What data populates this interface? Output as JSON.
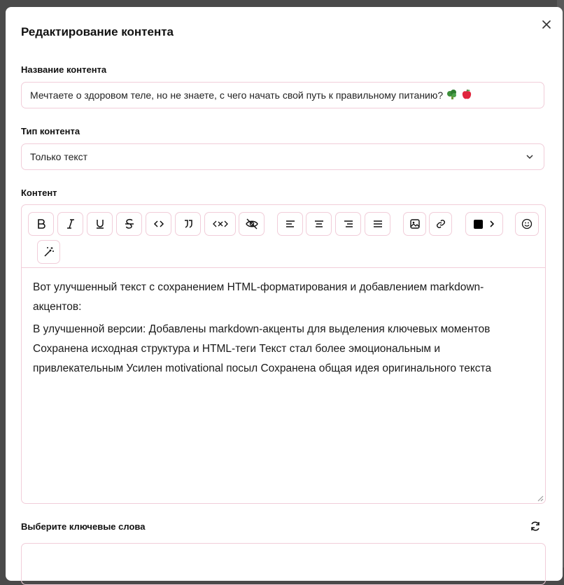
{
  "modal": {
    "title": "Редактирование контента",
    "close_icon": "close-icon"
  },
  "content_name": {
    "label": "Название контента",
    "value": "Мечтаете о здоровом теле, но не знаете, с чего начать свой путь к правильному питанию?",
    "emojis": [
      "broccoli-emoji",
      "apple-emoji"
    ]
  },
  "content_type": {
    "label": "Тип контента",
    "value": "Только текст"
  },
  "content": {
    "label": "Контент",
    "toolbar_icons": [
      "bold-icon",
      "italic-icon",
      "underline-icon",
      "strikethrough-icon",
      "code-icon",
      "quote-icon",
      "code-block-icon",
      "hide-icon",
      "align-left-icon",
      "align-center-icon",
      "align-right-icon",
      "align-justify-icon",
      "image-icon",
      "link-icon",
      "color-picker-icon",
      "emoji-icon",
      "magic-wand-icon"
    ],
    "text_color": "#000000",
    "paragraphs": [
      "Вот улучшенный текст с сохранением HTML-форматирования и добавлением markdown-акцентов:",
      "В улучшенной версии: Добавлены markdown-акценты для выделения ключевых моментов Сохранена исходная структура и HTML-теги Текст стал более эмоциональным и привлекательным Усилен motivational посыл Сохранена общая идея оригинального текста"
    ]
  },
  "keywords": {
    "label": "Выберите ключевые слова",
    "refresh_icon": "refresh-icon"
  },
  "colors": {
    "border": "#f1cdd9",
    "backdrop": "#4a4a4a"
  }
}
